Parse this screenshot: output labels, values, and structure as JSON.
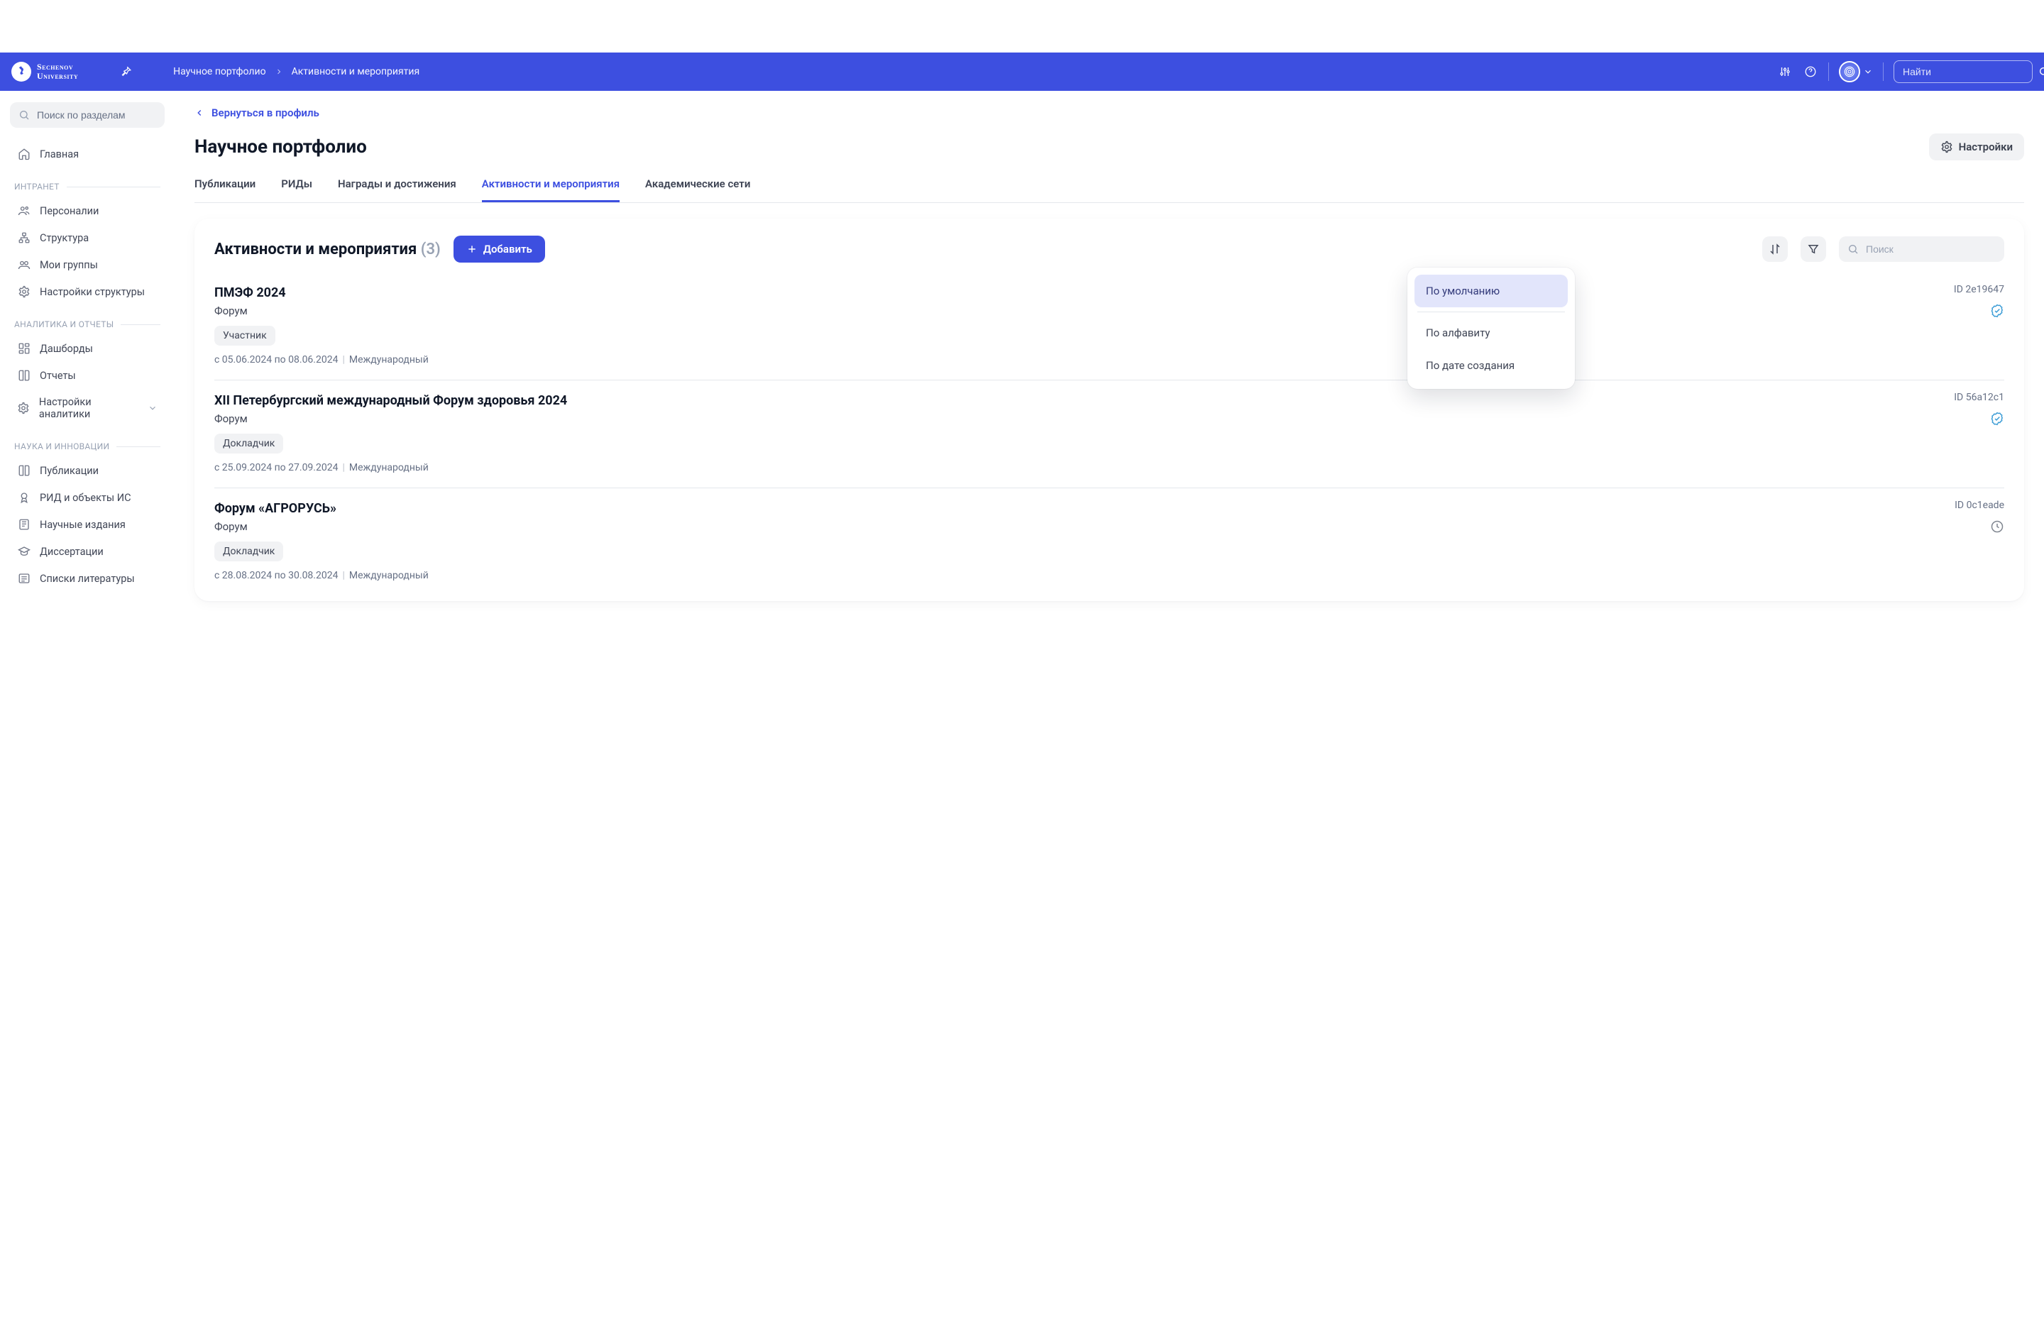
{
  "brand": {
    "line1": "Sechenov",
    "line2": "University"
  },
  "breadcrumb": {
    "root": "Научное портфолио",
    "current": "Активности и мероприятия"
  },
  "top_search": {
    "placeholder": "Найти"
  },
  "sidebar": {
    "search_placeholder": "Поиск по разделам",
    "home": "Главная",
    "groups": {
      "intranet": {
        "label": "ИНТРАНЕТ",
        "items": [
          "Персоналии",
          "Структура",
          "Мои группы",
          "Настройки структуры"
        ]
      },
      "analytics": {
        "label": "АНАЛИТИКА И ОТЧЕТЫ",
        "items": [
          "Дашборды",
          "Отчеты",
          "Настройки аналитики"
        ]
      },
      "science": {
        "label": "НАУКА И ИННОВАЦИИ",
        "items": [
          "Публикации",
          "РИД и объекты ИС",
          "Научные издания",
          "Диссертации",
          "Списки литературы"
        ]
      }
    }
  },
  "back_link": "Вернуться в профиль",
  "page_title": "Научное портфолио",
  "settings_label": "Настройки",
  "tabs": [
    "Публикации",
    "РИДы",
    "Награды и достижения",
    "Активности и мероприятия",
    "Академические сети"
  ],
  "active_tab_index": 3,
  "section": {
    "title": "Активности и мероприятия",
    "count": "(3)",
    "add_label": "Добавить",
    "search_placeholder": "Поиск"
  },
  "sort_popover": {
    "options": [
      "По умолчанию",
      "По алфавиту",
      "По дате создания"
    ],
    "selected_index": 0
  },
  "events": [
    {
      "title": "ПМЭФ 2024",
      "type": "Форум",
      "role": "Участник",
      "date_from": "05.06.2024",
      "date_to": "08.06.2024",
      "scope": "Международный",
      "id_label": "ID 2e19647",
      "status": "verified"
    },
    {
      "title": "XII Петербургский международный Форум здоровья 2024",
      "type": "Форум",
      "role": "Докладчик",
      "date_from": "25.09.2024",
      "date_to": "27.09.2024",
      "scope": "Международный",
      "id_label": "ID 56a12c1",
      "status": "verified"
    },
    {
      "title": "Форум «АГРОРУСЬ»",
      "type": "Форум",
      "role": "Докладчик",
      "date_from": "28.08.2024",
      "date_to": "30.08.2024",
      "scope": "Международный",
      "id_label": "ID 0c1eade",
      "status": "pending"
    }
  ],
  "meta_words": {
    "from": "с",
    "to": "по"
  }
}
